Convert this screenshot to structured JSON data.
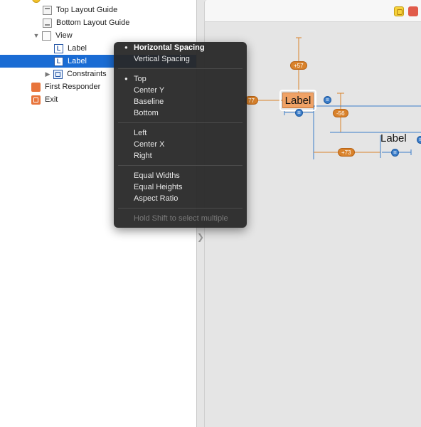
{
  "outline": {
    "items": [
      {
        "label": "Top Layout Guide",
        "icon": "top-layout-guide-icon"
      },
      {
        "label": "Bottom Layout Guide",
        "icon": "bottom-layout-guide-icon"
      },
      {
        "label": "View",
        "icon": "view-icon"
      },
      {
        "label": "Label",
        "icon": "label-icon"
      },
      {
        "label": "Label",
        "icon": "label-icon",
        "selected": true
      },
      {
        "label": "Constraints",
        "icon": "constraints-icon"
      },
      {
        "label": "First Responder",
        "icon": "first-responder-icon"
      },
      {
        "label": "Exit",
        "icon": "exit-icon"
      }
    ],
    "label_icon_glyph": "L"
  },
  "canvas": {
    "label1": "Label",
    "label2": "Label",
    "badges": {
      "top": "+57",
      "left": "77",
      "vertical": "-56",
      "horizontal": "+73"
    },
    "equal_glyph": "="
  },
  "popup": {
    "bullet": "●",
    "groups": [
      [
        {
          "label": "Horizontal Spacing",
          "selected": true
        },
        {
          "label": "Vertical Spacing"
        }
      ],
      [
        {
          "label": "Top",
          "selected": true
        },
        {
          "label": "Center Y"
        },
        {
          "label": "Baseline"
        },
        {
          "label": "Bottom"
        }
      ],
      [
        {
          "label": "Left"
        },
        {
          "label": "Center X"
        },
        {
          "label": "Right"
        }
      ],
      [
        {
          "label": "Equal Widths"
        },
        {
          "label": "Equal Heights"
        },
        {
          "label": "Aspect Ratio"
        }
      ]
    ],
    "hint": "Hold Shift to select multiple"
  },
  "colors": {
    "selection": "#1a6cd4",
    "constraint_orange": "#d9822b",
    "constraint_blue": "#3b7dc9",
    "popup_bg": "#282828"
  }
}
